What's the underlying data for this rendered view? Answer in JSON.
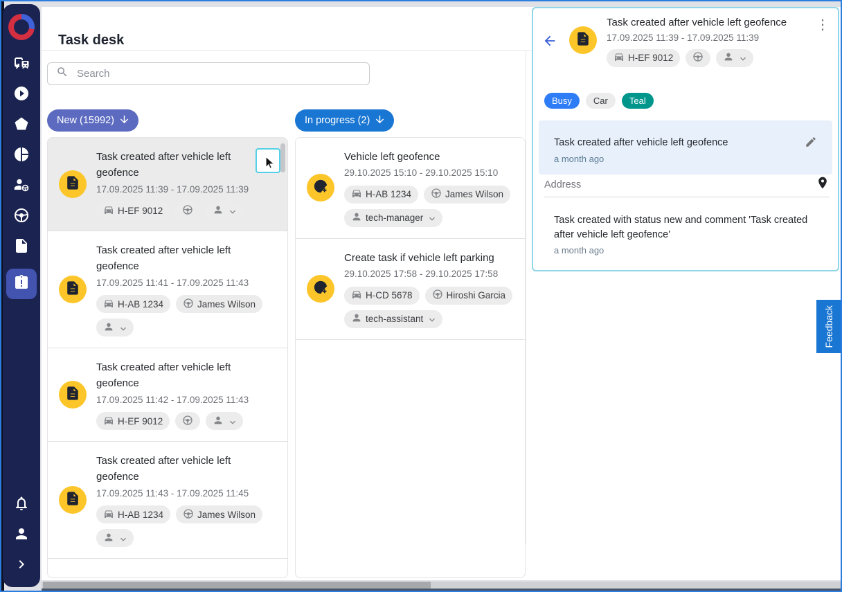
{
  "app": {
    "title": "Task desk"
  },
  "sidebar": {
    "items": [
      "fleet",
      "playback",
      "geofences",
      "reports",
      "drivers",
      "steering",
      "documents",
      "tasks",
      "notifications",
      "profile",
      "expand"
    ],
    "active_item": "tasks"
  },
  "search": {
    "placeholder": "Search"
  },
  "board": {
    "columns": [
      {
        "label": "New (15992)",
        "color": "#5c6bc0",
        "cards": [
          {
            "title": "Task created after vehicle left geofence",
            "date": "17.09.2025 11:39 - 17.09.2025 11:39",
            "vehicle": "H-EF 9012",
            "driver": null,
            "assignee": null
          },
          {
            "title": "Task created after vehicle left geofence",
            "date": "17.09.2025 11:41 - 17.09.2025 11:43",
            "vehicle": "H-AB 1234",
            "driver": "James Wilson",
            "assignee": null
          },
          {
            "title": "Task created after vehicle left geofence",
            "date": "17.09.2025 11:42 - 17.09.2025 11:43",
            "vehicle": "H-EF 9012",
            "driver": null,
            "assignee": null
          },
          {
            "title": "Task created after vehicle left geofence",
            "date": "17.09.2025 11:43 - 17.09.2025 11:45",
            "vehicle": "H-AB 1234",
            "driver": "James Wilson",
            "assignee": null
          }
        ]
      },
      {
        "label": "In progress (2)",
        "color": "#1976d2",
        "cards": [
          {
            "title": "Vehicle left geofence",
            "date": "29.10.2025 15:10 - 29.10.2025 15:10",
            "vehicle": "H-AB 1234",
            "driver": "James Wilson",
            "assignee": "tech-manager"
          },
          {
            "title": "Create task if vehicle left parking",
            "date": "29.10.2025 17:58 - 29.10.2025 17:58",
            "vehicle": "H-CD 5678",
            "driver": "Hiroshi Garcia",
            "assignee": "tech-assistant"
          }
        ]
      }
    ]
  },
  "panel": {
    "title": "Task created after vehicle left geofence",
    "date": "17.09.2025 11:39 - 17.09.2025 11:39",
    "vehicle": "H-EF 9012",
    "tags": {
      "busy": "Busy",
      "car": "Car",
      "teal": "Teal"
    },
    "comment": {
      "text": "Task created after vehicle left geofence",
      "time": "a month ago"
    },
    "address_label": "Address",
    "history": {
      "text": "Task created with status new and comment 'Task created after vehicle left geofence'",
      "time": "a month ago"
    },
    "kebab": "⋮"
  },
  "feedback": {
    "label": "Feedback"
  },
  "colors": {
    "sidebar_bg": "#1b2351",
    "sidebar_active": "#4353b0",
    "avatar_yellow": "#fcc62b",
    "new_pill": "#5c6bc0",
    "progress_pill": "#1976d2",
    "panel_border": "#8fd6e8",
    "tag_busy": "#2e7cf6",
    "tag_teal": "#00968c",
    "comment_bg": "#e7f0fb",
    "feedback_blue": "#1976d2"
  }
}
